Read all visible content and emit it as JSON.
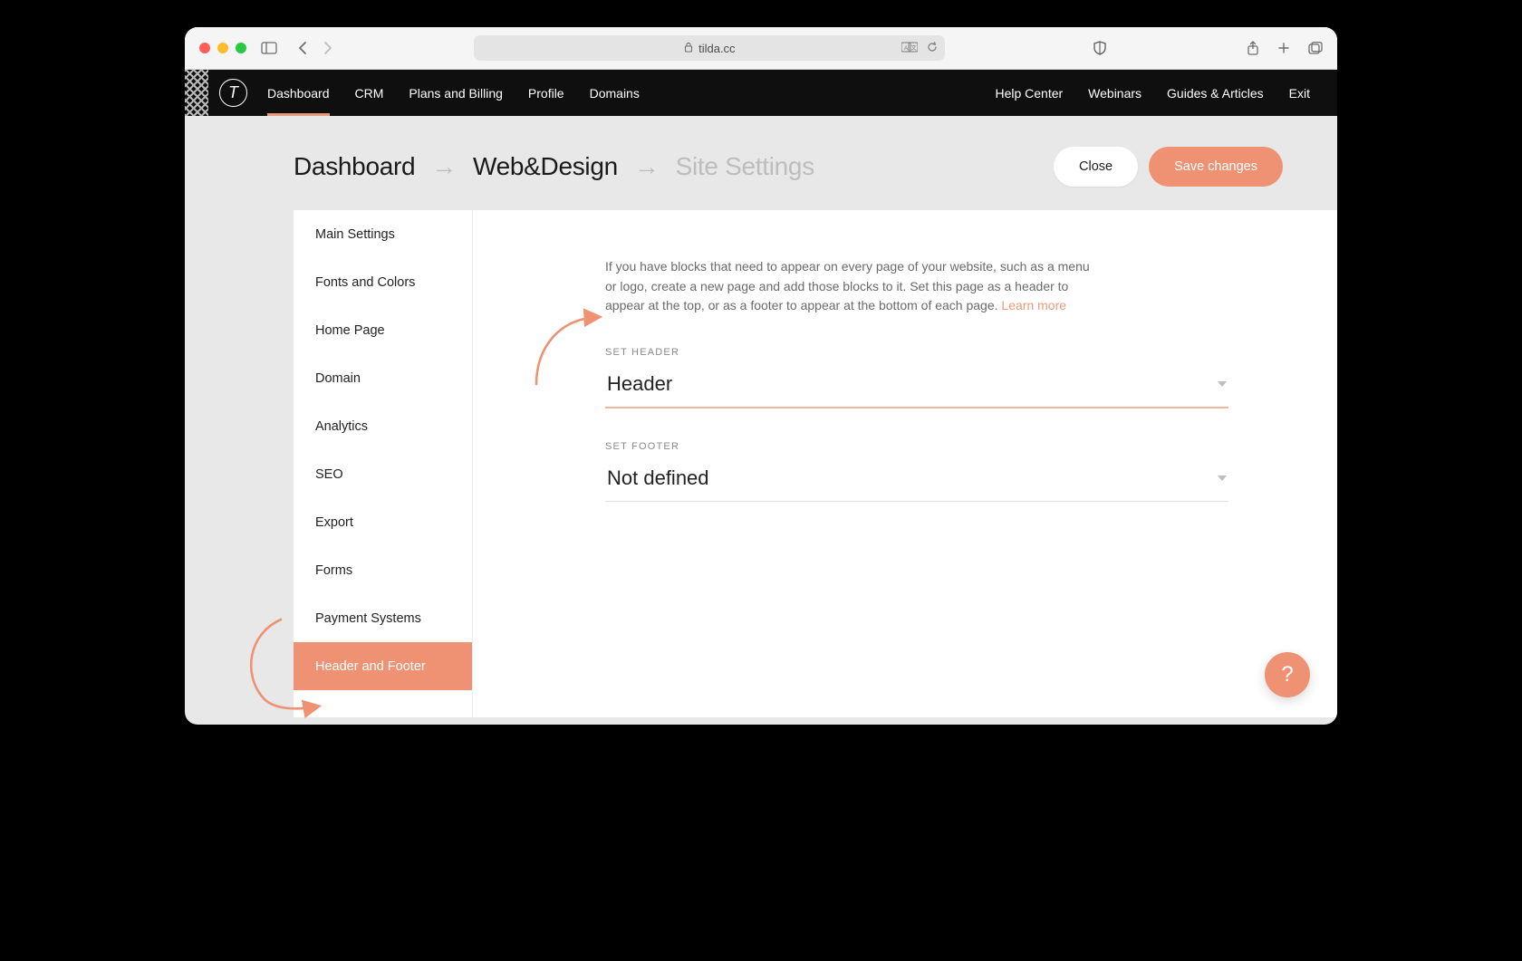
{
  "browser": {
    "url_host": "tilda.cc"
  },
  "app_nav": {
    "logo_letter": "T",
    "left": [
      "Dashboard",
      "CRM",
      "Plans and Billing",
      "Profile",
      "Domains"
    ],
    "left_active_index": 0,
    "right": [
      "Help Center",
      "Webinars",
      "Guides & Articles",
      "Exit"
    ]
  },
  "breadcrumb": {
    "items": [
      "Dashboard",
      "Web&Design",
      "Site Settings"
    ],
    "dim_index": 2,
    "separator": "→"
  },
  "actions": {
    "close": "Close",
    "save": "Save changes"
  },
  "sidebar": {
    "items": [
      "Main Settings",
      "Fonts and Colors",
      "Home Page",
      "Domain",
      "Analytics",
      "SEO",
      "Export",
      "Forms",
      "Payment Systems",
      "Header and Footer"
    ],
    "active_index": 9
  },
  "content": {
    "description": "If you have blocks that need to appear on every page of your website, such as a menu or logo, create a new page and add those blocks to it. Set this page as a header to appear at the top, or as a footer to appear at the bottom of each page. ",
    "learn_more": "Learn more",
    "fields": [
      {
        "label": "SET HEADER",
        "value": "Header",
        "highlight": true
      },
      {
        "label": "SET FOOTER",
        "value": "Not defined",
        "highlight": false
      }
    ]
  },
  "help_label": "?"
}
